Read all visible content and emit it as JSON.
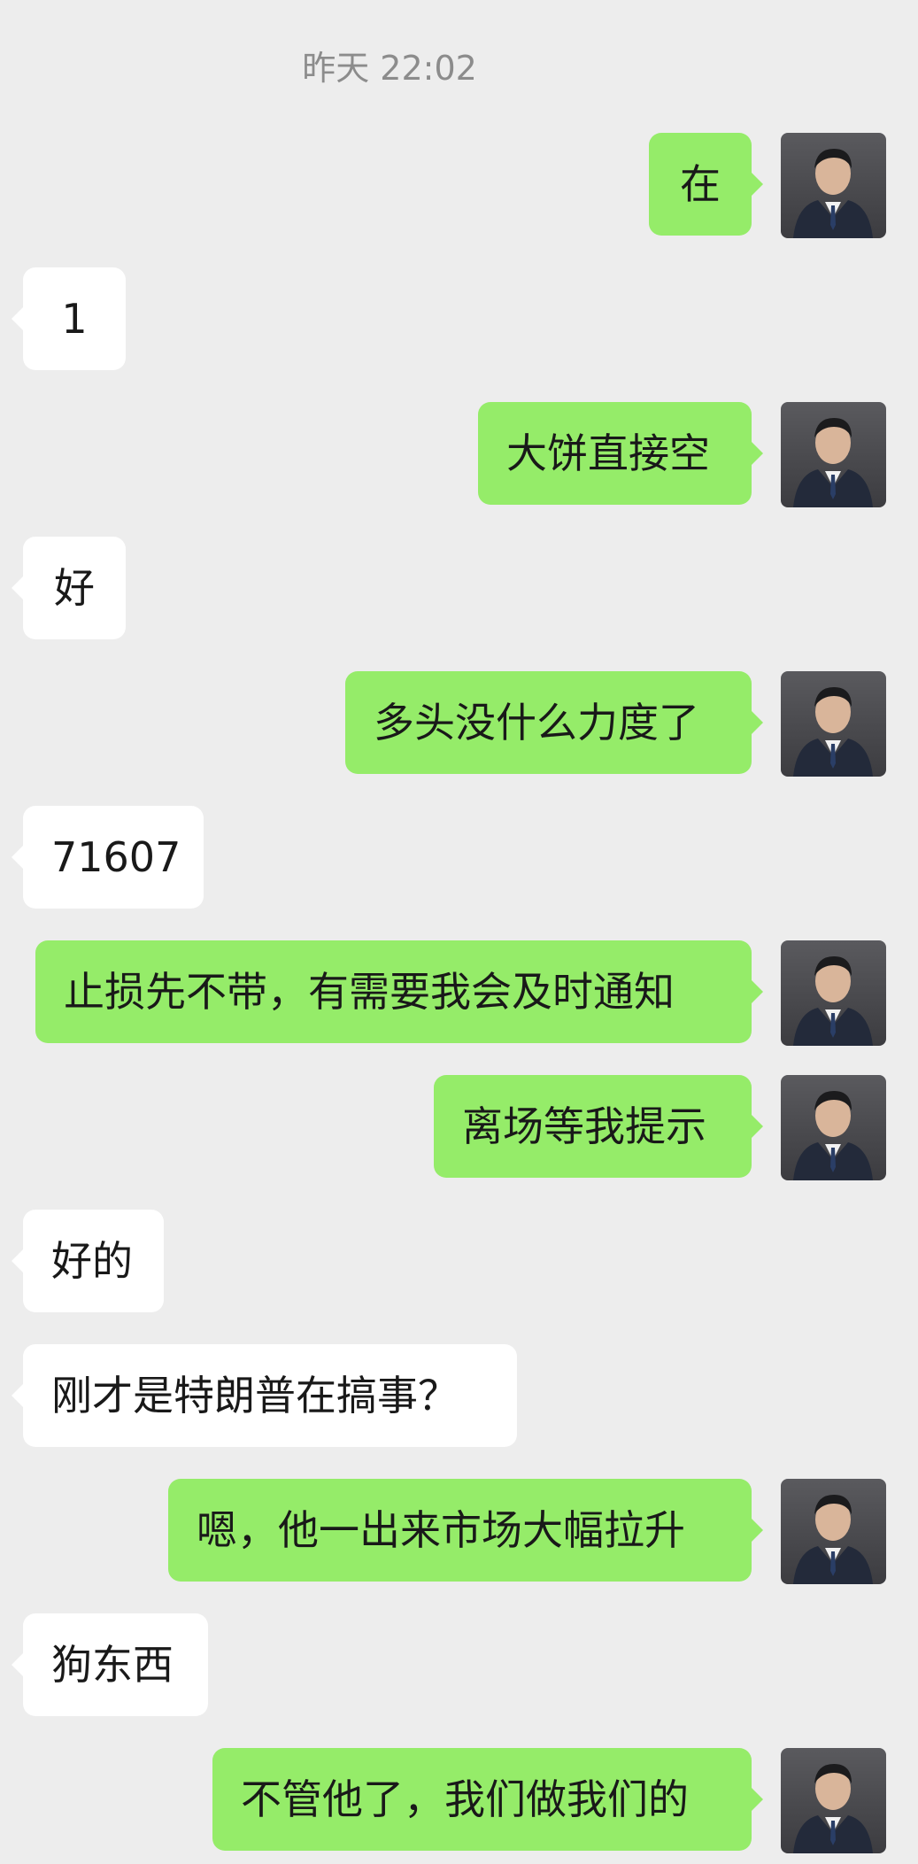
{
  "timestamp": "昨天 22:02",
  "messages": [
    {
      "side": "right",
      "text": "在"
    },
    {
      "side": "left",
      "text": "1"
    },
    {
      "side": "right",
      "text": "大饼直接空"
    },
    {
      "side": "left",
      "text": "好"
    },
    {
      "side": "right",
      "text": "多头没什么力度了"
    },
    {
      "side": "left",
      "text": "71607"
    },
    {
      "side": "right",
      "text": "止损先不带，有需要我会及时通知"
    },
    {
      "side": "right",
      "text": "离场等我提示"
    },
    {
      "side": "left",
      "text": "好的"
    },
    {
      "side": "left",
      "text": "刚才是特朗普在搞事？"
    },
    {
      "side": "right",
      "text": "嗯，他一出来市场大幅拉升"
    },
    {
      "side": "left",
      "text": "狗东西"
    },
    {
      "side": "right",
      "text": "不管他了，我们做我们的"
    }
  ],
  "avatar": {
    "icon": "user-avatar-man-in-suit"
  }
}
